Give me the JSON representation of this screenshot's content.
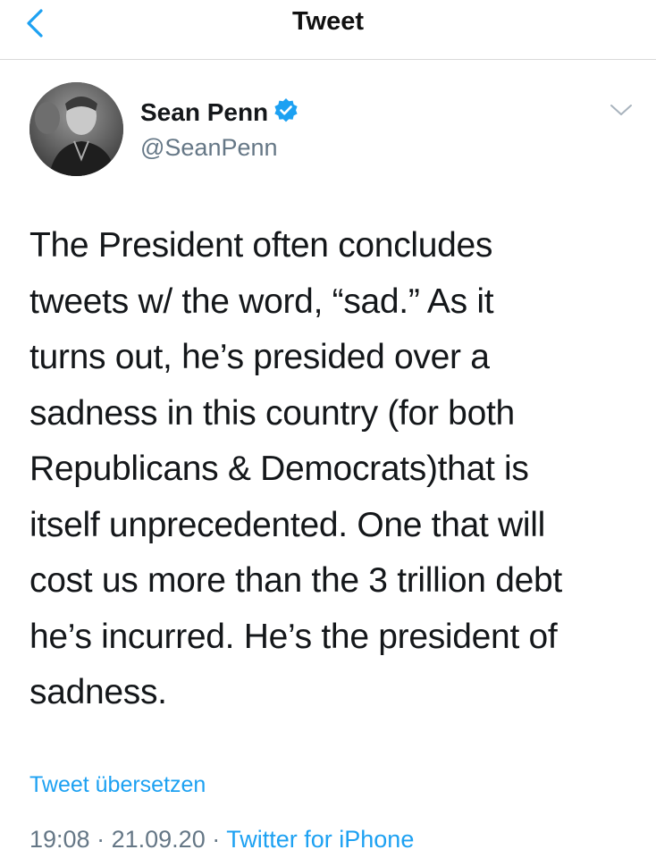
{
  "header": {
    "title": "Tweet",
    "back_icon": "chevron-left-icon"
  },
  "author": {
    "display_name": "Sean Penn",
    "handle": "@SeanPenn",
    "verified_icon": "verified-badge-icon"
  },
  "menu_icon": "chevron-down-icon",
  "tweet": {
    "lines": [
      "The President often concludes",
      "tweets w/ the word, “sad.” As it",
      "turns out, he’s presided over a",
      "sadness in this country (for both",
      "Republicans & Democrats)that is",
      "itself unprecedented. One that will",
      "cost us more than the 3 trillion debt",
      "he’s incurred. He’s the president of",
      "sadness."
    ],
    "translate_label": "Tweet übersetzen"
  },
  "meta": {
    "time": "19:08",
    "separator": "·",
    "date": "21.09.20",
    "source": "Twitter for iPhone"
  },
  "colors": {
    "accent": "#1da1f2",
    "text": "#14171a",
    "secondary": "#657786"
  }
}
